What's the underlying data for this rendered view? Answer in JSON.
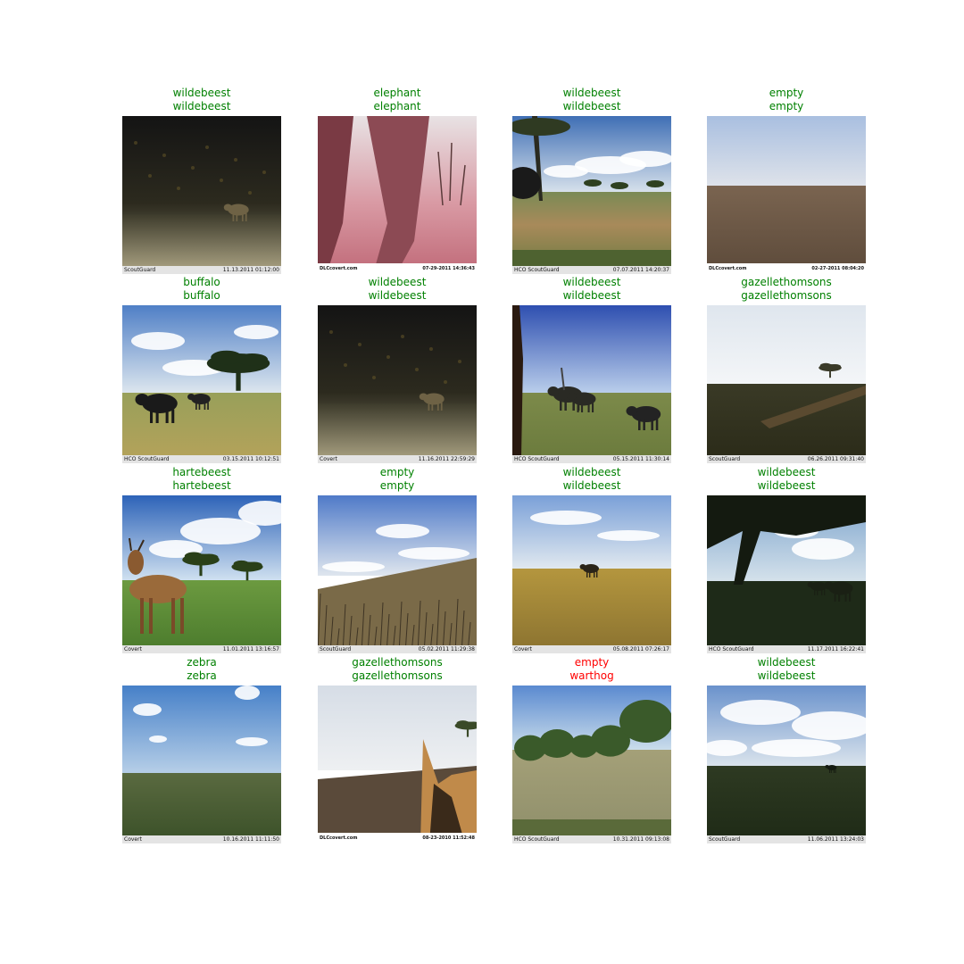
{
  "colors": {
    "correct": "#008000",
    "incorrect": "#ff0000"
  },
  "grid": [
    {
      "pred": "wildebeest",
      "truth": "wildebeest",
      "correct": true,
      "brand": "ScoutGuard",
      "timestamp": "11.13.2011 01:12:00",
      "scene": "night-dark"
    },
    {
      "pred": "elephant",
      "truth": "elephant",
      "correct": true,
      "brand": "DLCcovert.com",
      "timestamp": "07-29-2011  14:36:43",
      "scene": "elephant-leg"
    },
    {
      "pred": "wildebeest",
      "truth": "wildebeest",
      "correct": true,
      "brand": "HCO ScoutGuard",
      "timestamp": "07.07.2011 14:20:37",
      "scene": "savanna-tree"
    },
    {
      "pred": "empty",
      "truth": "empty",
      "correct": true,
      "brand": "DLCcovert.com",
      "timestamp": "02-27-2011  08:04:20",
      "scene": "plain"
    },
    {
      "pred": "buffalo",
      "truth": "buffalo",
      "correct": true,
      "brand": "HCO ScoutGuard",
      "timestamp": "03.15.2011 10:12:51",
      "scene": "buffalo"
    },
    {
      "pred": "wildebeest",
      "truth": "wildebeest",
      "correct": true,
      "brand": "Covert",
      "timestamp": "11.16.2011 22:59:29",
      "scene": "night-dark"
    },
    {
      "pred": "wildebeest",
      "truth": "wildebeest",
      "correct": true,
      "brand": "HCO ScoutGuard",
      "timestamp": "05.15.2011 11:30:14",
      "scene": "wildebeest-herd"
    },
    {
      "pred": "gazellethomsons",
      "truth": "gazellethomsons",
      "correct": true,
      "brand": "ScoutGuard",
      "timestamp": "06.26.2011 09:31:40",
      "scene": "bright-dark"
    },
    {
      "pred": "hartebeest",
      "truth": "hartebeest",
      "correct": true,
      "brand": "Covert",
      "timestamp": "11.01.2011 13:16:57",
      "scene": "hartebeest"
    },
    {
      "pred": "empty",
      "truth": "empty",
      "correct": true,
      "brand": "ScoutGuard",
      "timestamp": "05.02.2011 11:29:38",
      "scene": "grass-hill"
    },
    {
      "pred": "wildebeest",
      "truth": "wildebeest",
      "correct": true,
      "brand": "Covert",
      "timestamp": "05.08.2011 07:26:17",
      "scene": "golden-plain"
    },
    {
      "pred": "wildebeest",
      "truth": "wildebeest",
      "correct": true,
      "brand": "HCO ScoutGuard",
      "timestamp": "11.17.2011 16:22:41",
      "scene": "dark-tree"
    },
    {
      "pred": "zebra",
      "truth": "zebra",
      "correct": true,
      "brand": "Covert",
      "timestamp": "10.16.2011 11:11:50",
      "scene": "green-plain"
    },
    {
      "pred": "gazellethomsons",
      "truth": "gazellethomsons",
      "correct": true,
      "brand": "DLCcovert.com",
      "timestamp": "08-23-2010  11:52:48",
      "scene": "gazelle-ear"
    },
    {
      "pred": "empty",
      "truth": "warthog",
      "correct": false,
      "brand": "HCO ScoutGuard",
      "timestamp": "10.31.2011 09:13:08",
      "scene": "bushes"
    },
    {
      "pred": "wildebeest",
      "truth": "wildebeest",
      "correct": true,
      "brand": "ScoutGuard",
      "timestamp": "11.06.2011 13:24:03",
      "scene": "cloudy-dark"
    }
  ]
}
